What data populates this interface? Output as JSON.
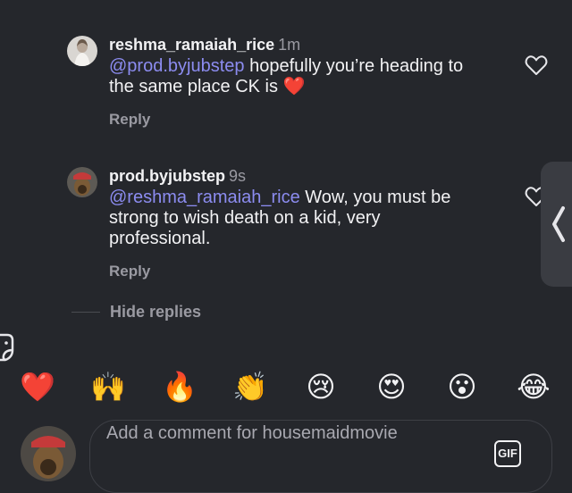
{
  "comments": [
    {
      "username": "reshma_ramaiah_rice",
      "time": "1m",
      "mention": "@prod.byjubstep",
      "text": " hopefully you’re heading to the same place CK is ",
      "emoji": "❤️",
      "reply_label": "Reply"
    },
    {
      "username": "prod.byjubstep",
      "time": "9s",
      "mention": "@reshma_ramaiah_rice",
      "text": " Wow, you must be strong to wish death on a kid, very professional.",
      "reply_label": "Reply"
    }
  ],
  "hide_replies_label": "Hide replies",
  "emoji_bar": [
    "❤️",
    "🙌",
    "🔥",
    "👏",
    "😢",
    "😍",
    "😮",
    "😂"
  ],
  "composer": {
    "placeholder": "Add a comment for housemaidmovie",
    "gif_label": "GIF"
  },
  "colors": {
    "background": "#25272c",
    "mention": "#8c8cf0",
    "muted_text": "#9a9aa2"
  },
  "icons": [
    "heart-outline-icon",
    "chevron-left-icon",
    "sticker-icon",
    "gif-icon"
  ]
}
